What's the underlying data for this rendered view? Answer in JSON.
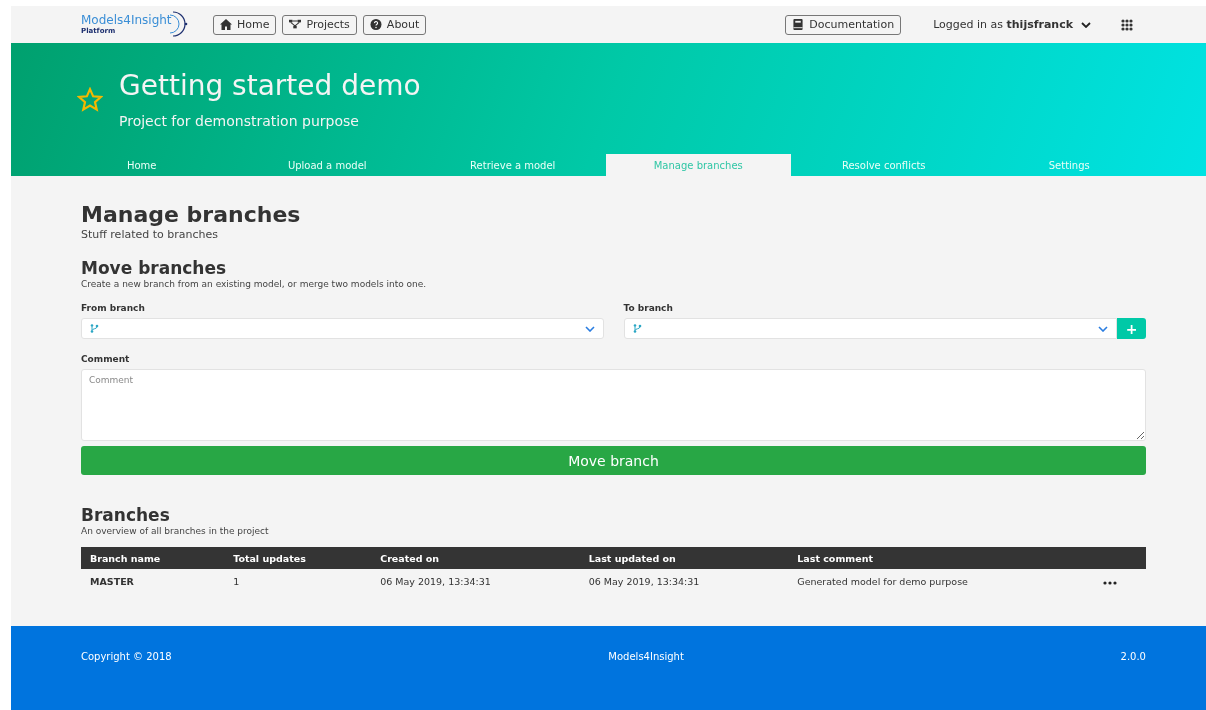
{
  "navbar": {
    "logo": {
      "name": "Models4Insight",
      "subtitle": "Platform"
    },
    "buttons": [
      {
        "label": "Home"
      },
      {
        "label": "Projects"
      },
      {
        "label": "About"
      }
    ],
    "documentation": {
      "label": "Documentation"
    },
    "user": {
      "prefix": "Logged in as",
      "name": "thijsfranck"
    }
  },
  "hero": {
    "favorite": false,
    "title": "Getting started demo",
    "subtitle": "Project for demonstration purpose"
  },
  "tabs": [
    {
      "label": "Home",
      "selected": false
    },
    {
      "label": "Upload a model",
      "selected": false
    },
    {
      "label": "Retrieve a model",
      "selected": false
    },
    {
      "label": "Manage branches",
      "selected": true
    },
    {
      "label": "Resolve conflicts",
      "selected": false
    },
    {
      "label": "Settings",
      "selected": false
    }
  ],
  "page": {
    "title": "Manage branches",
    "subtitle": "Stuff related to branches"
  },
  "move": {
    "title": "Move branches",
    "description": "Create a new branch from an existing model, or merge two models into one.",
    "from_label": "From branch",
    "to_label": "To branch",
    "add_button": "+",
    "comment_label": "Comment",
    "comment_placeholder": "Comment",
    "button": "Move branch"
  },
  "branches": {
    "title": "Branches",
    "description": "An overview of all branches in the project",
    "columns": [
      "Branch name",
      "Total updates",
      "Created on",
      "Last updated on",
      "Last comment"
    ],
    "rows": [
      {
        "cells": [
          "MASTER",
          "1",
          "06 May 2019, 13:34:31",
          "06 May 2019, 13:34:31",
          "Generated model for demo purpose"
        ]
      }
    ]
  },
  "footer": {
    "copyright": "Copyright © 2018",
    "name": "Models4Insight",
    "version": "2.0.0"
  }
}
